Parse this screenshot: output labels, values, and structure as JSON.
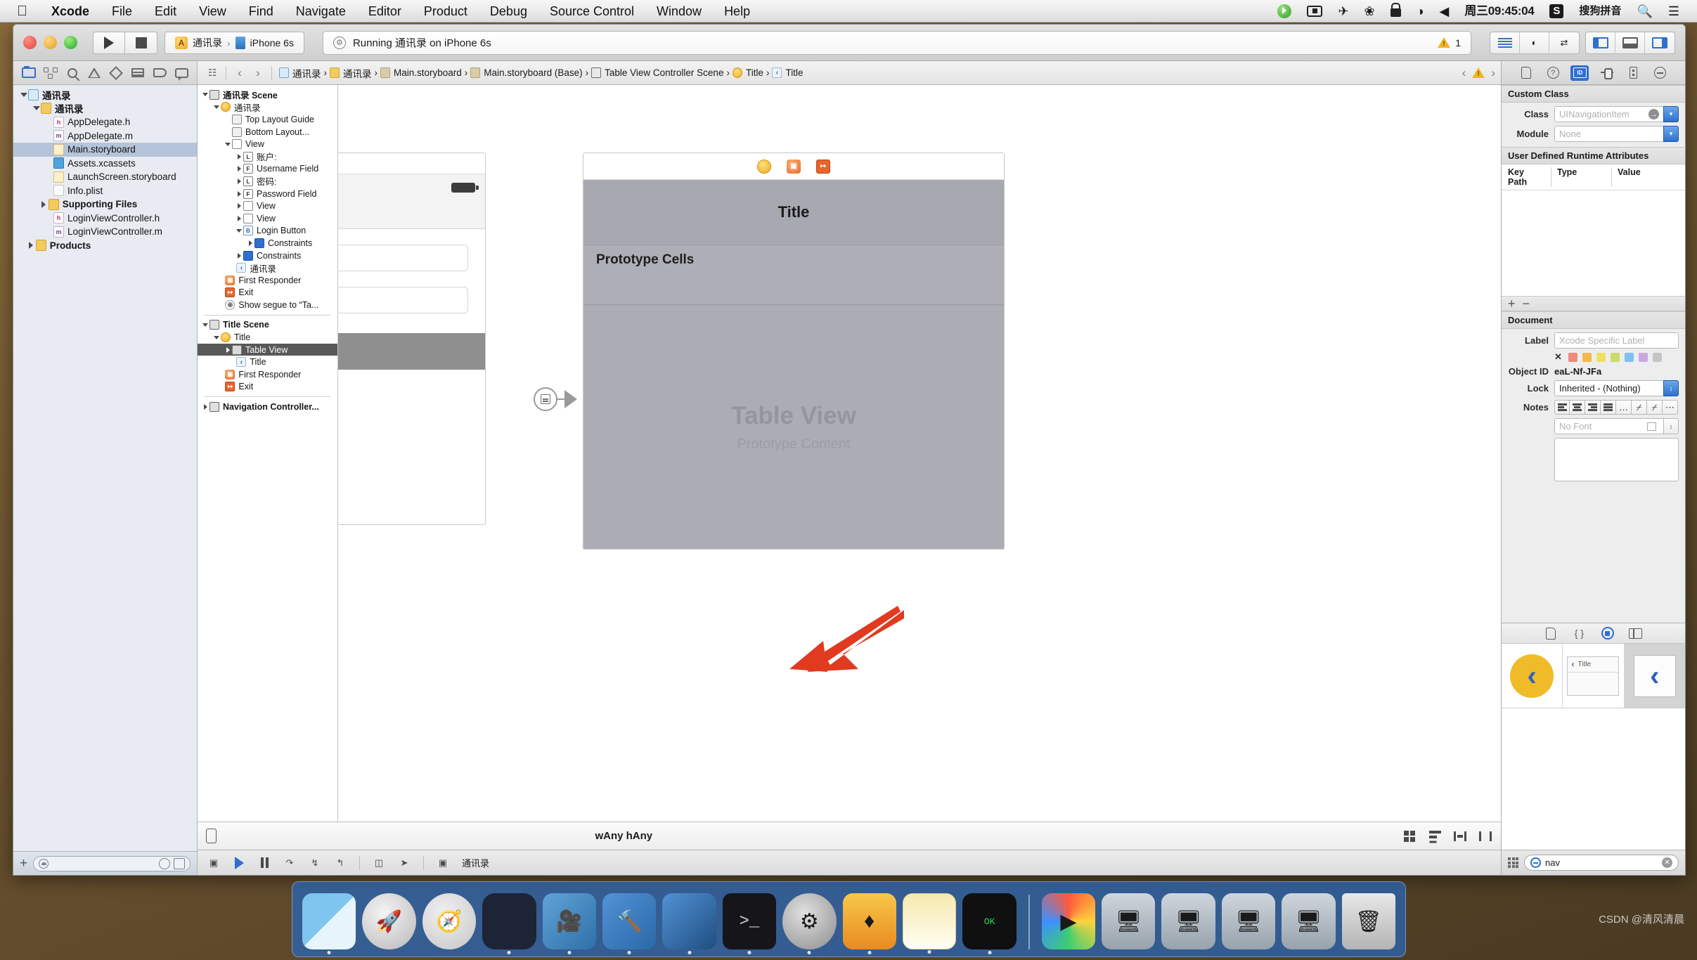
{
  "menubar": {
    "apple": "apple-logo",
    "items": [
      "Xcode",
      "File",
      "Edit",
      "View",
      "Find",
      "Navigate",
      "Editor",
      "Product",
      "Debug",
      "Source Control",
      "Window",
      "Help"
    ],
    "clock": "周三09:45:04",
    "ime": "搜狗拼音",
    "status_icons": [
      "screen-record-icon",
      "airplane-icon",
      "bluetooth-icon",
      "lock-icon",
      "wifi-icon",
      "volume-icon"
    ]
  },
  "toolbar": {
    "run_label": "play-icon",
    "stop_label": "stop-icon",
    "scheme_project": "通讯录",
    "scheme_device": "iPhone 6s",
    "activity_status": "Running 通讯录 on iPhone 6s",
    "issue_count": "1"
  },
  "navigator": {
    "tabs": [
      "project-navigator",
      "source-control-navigator",
      "symbol-navigator",
      "find-navigator",
      "issue-navigator",
      "test-navigator",
      "debug-navigator",
      "breakpoint-navigator",
      "report-navigator"
    ],
    "files": [
      {
        "label": "通讯录",
        "kind": "proj",
        "depth": 0,
        "twist": "open"
      },
      {
        "label": "通讯录",
        "kind": "fold",
        "depth": 1,
        "twist": "open"
      },
      {
        "label": "AppDelegate.h",
        "kind": "h",
        "depth": 2,
        "twist": "none"
      },
      {
        "label": "AppDelegate.m",
        "kind": "m",
        "depth": 2,
        "twist": "none"
      },
      {
        "label": "Main.storyboard",
        "kind": "sb",
        "depth": 2,
        "twist": "none",
        "selected": true
      },
      {
        "label": "Assets.xcassets",
        "kind": "xca",
        "depth": 2,
        "twist": "none"
      },
      {
        "label": "LaunchScreen.storyboard",
        "kind": "sb",
        "depth": 2,
        "twist": "none"
      },
      {
        "label": "Info.plist",
        "kind": "plist",
        "depth": 2,
        "twist": "none"
      },
      {
        "label": "Supporting Files",
        "kind": "fold",
        "depth": 1.6,
        "twist": "closed"
      },
      {
        "label": "LoginViewController.h",
        "kind": "h",
        "depth": 2,
        "twist": "none"
      },
      {
        "label": "LoginViewController.m",
        "kind": "m",
        "depth": 2,
        "twist": "none"
      },
      {
        "label": "Products",
        "kind": "fold",
        "depth": 0.6,
        "twist": "closed"
      }
    ],
    "filter_placeholder": ""
  },
  "jumpbar": {
    "crumbs": [
      {
        "label": "通讯录",
        "icon": "proj"
      },
      {
        "label": "通讯录",
        "icon": "fold"
      },
      {
        "label": "Main.storyboard",
        "icon": "sb"
      },
      {
        "label": "Main.storyboard (Base)",
        "icon": "sb"
      },
      {
        "label": "Table View Controller Scene",
        "icon": "scene"
      },
      {
        "label": "Title",
        "icon": "vc"
      },
      {
        "label": "Title",
        "icon": "navitem"
      }
    ]
  },
  "outline": {
    "rows": [
      {
        "label": "通讯录 Scene",
        "icon": "scene",
        "depth": 0,
        "twist": "open",
        "bold": true
      },
      {
        "label": "通讯录",
        "icon": "vc",
        "depth": 1,
        "twist": "open"
      },
      {
        "label": "Top Layout Guide",
        "icon": "guide",
        "depth": 2,
        "twist": "none"
      },
      {
        "label": "Bottom Layout...",
        "icon": "guide",
        "depth": 2,
        "twist": "none"
      },
      {
        "label": "View",
        "icon": "view",
        "depth": 2,
        "twist": "open"
      },
      {
        "label": "账户:",
        "icon": "lab",
        "glyph": "L",
        "depth": 3,
        "twist": "closed"
      },
      {
        "label": "Username Field",
        "icon": "fld",
        "glyph": "F",
        "depth": 3,
        "twist": "closed"
      },
      {
        "label": "密码:",
        "icon": "lab",
        "glyph": "L",
        "depth": 3,
        "twist": "closed"
      },
      {
        "label": "Password Field",
        "icon": "fld",
        "glyph": "F",
        "depth": 3,
        "twist": "closed"
      },
      {
        "label": "View",
        "icon": "view",
        "depth": 3,
        "twist": "closed"
      },
      {
        "label": "View",
        "icon": "view",
        "depth": 3,
        "twist": "closed"
      },
      {
        "label": "Login Button",
        "icon": "btn",
        "glyph": "B",
        "depth": 3,
        "twist": "open"
      },
      {
        "label": "Constraints",
        "icon": "cons",
        "depth": 4,
        "twist": "closed"
      },
      {
        "label": "Constraints",
        "icon": "cons",
        "depth": 3,
        "twist": "closed"
      },
      {
        "label": "通讯录",
        "icon": "navitem",
        "glyph": "‹",
        "depth": 2.4,
        "twist": "none"
      },
      {
        "label": "First Responder",
        "icon": "fr",
        "depth": 1.4,
        "twist": "none"
      },
      {
        "label": "Exit",
        "icon": "exit",
        "depth": 1.4,
        "twist": "none"
      },
      {
        "label": "Show segue to “Ta...",
        "icon": "segue",
        "depth": 1.4,
        "twist": "none"
      }
    ],
    "rows2": [
      {
        "label": "Title Scene",
        "icon": "scene",
        "depth": 0,
        "twist": "open",
        "bold": true
      },
      {
        "label": "Title",
        "icon": "vc",
        "depth": 1,
        "twist": "open"
      },
      {
        "label": "Table View",
        "icon": "tbl",
        "depth": 2,
        "twist": "closed",
        "selected": true
      },
      {
        "label": "Title",
        "icon": "navitem",
        "glyph": "‹",
        "depth": 2.4,
        "twist": "none"
      },
      {
        "label": "First Responder",
        "icon": "fr",
        "depth": 1.4,
        "twist": "none"
      },
      {
        "label": "Exit",
        "icon": "exit",
        "depth": 1.4,
        "twist": "none"
      }
    ],
    "rows3": [
      {
        "label": "Navigation Controller...",
        "icon": "navc",
        "depth": 0,
        "twist": "closed",
        "bold": true
      }
    ]
  },
  "canvas": {
    "table_scene": {
      "nav_title": "Title",
      "prototype_cells_label": "Prototype Cells",
      "placeholder_title": "Table View",
      "placeholder_subtitle": "Prototype Content"
    }
  },
  "canvas_bottom": {
    "size_class": "Any",
    "size_class_w_prefix": "w",
    "size_class_h_prefix": "h",
    "size_class_label": "wAny hAny"
  },
  "editor_bottom": {
    "scheme_label": "通讯录"
  },
  "inspector": {
    "tabs": [
      "file-inspector",
      "quick-help-inspector",
      "identity-inspector",
      "attributes-inspector",
      "size-inspector",
      "connections-inspector"
    ],
    "active_tab": "identity-inspector",
    "custom_class": {
      "header": "Custom Class",
      "class_label": "Class",
      "class_value": "UINavigationItem",
      "module_label": "Module",
      "module_value": "None"
    },
    "user_defined": {
      "header": "User Defined Runtime Attributes",
      "columns": [
        "Key Path",
        "Type",
        "Value"
      ],
      "add_label": "+",
      "remove_label": "−"
    },
    "document": {
      "header": "Document",
      "label_label": "Label",
      "label_placeholder": "Xcode Specific Label",
      "object_id_label": "Object ID",
      "object_id_value": "eaL-Nf-JFa",
      "lock_label": "Lock",
      "lock_value": "Inherited - (Nothing)",
      "notes_label": "Notes",
      "font_placeholder": "No Font",
      "swatch_colors": [
        "#ef8a7c",
        "#f3b84e",
        "#efe063",
        "#c8dd6a",
        "#7ec0ef",
        "#c9a8e0",
        "#c4c4c4"
      ]
    }
  },
  "library": {
    "tabs": [
      "file-template-library",
      "code-snippet-library",
      "object-library",
      "media-library"
    ],
    "active_tab": "object-library",
    "preview_title": "Title",
    "search_value": "nav"
  },
  "dock": {
    "items": [
      "Finder",
      "Launchpad",
      "Safari",
      "Mouse",
      "iMovie",
      "Xcode",
      "Xcode",
      "Terminal",
      "System Preferences",
      "Sketch",
      "Notes",
      "exec",
      "Media Player",
      "Window",
      "Window",
      "Window",
      "Window",
      "Trash"
    ]
  },
  "watermark": {
    "text": "CSDN @清风清晨"
  }
}
